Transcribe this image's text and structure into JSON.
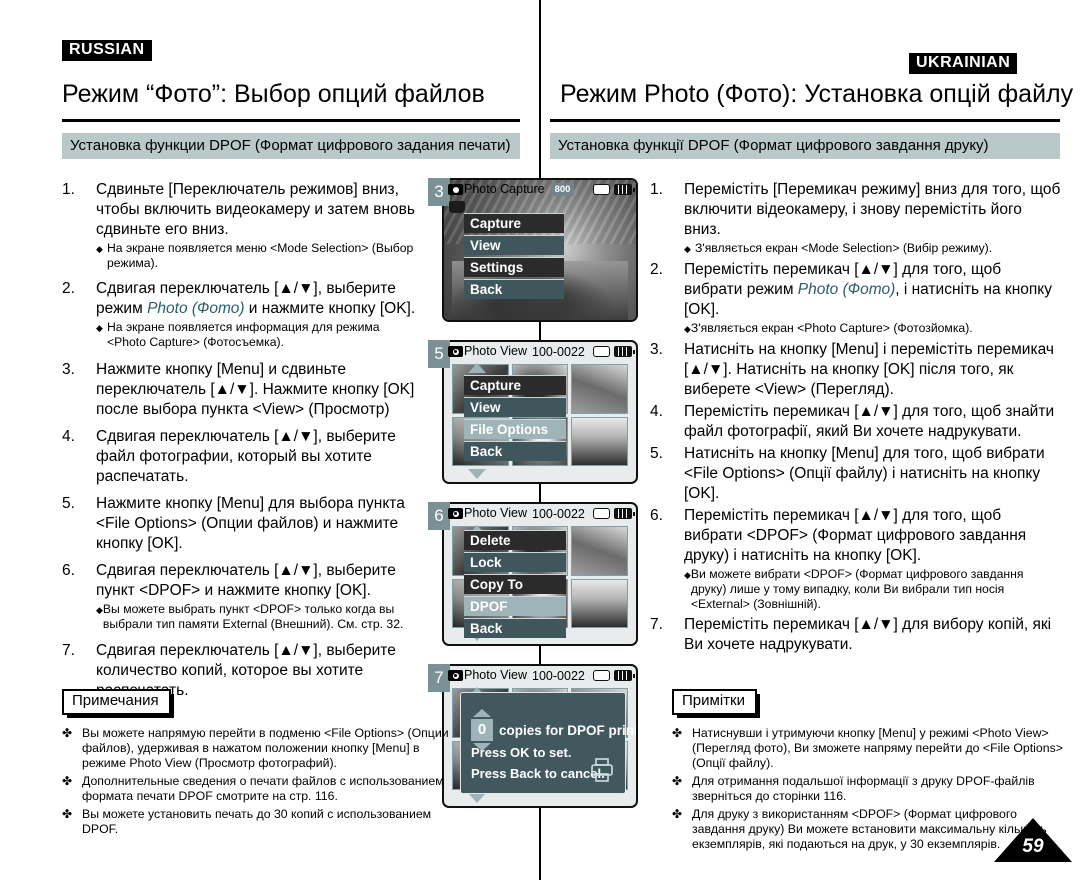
{
  "languages": {
    "left_tag": "RUSSIAN",
    "right_tag": "UKRAINIAN"
  },
  "left": {
    "chapter_title": "Режим “Фото”: Выбор опций файлов",
    "section_bar": "Установка функции DPOF (Формат цифрового задания печати)",
    "steps": [
      {
        "num": "1.",
        "text": "Сдвиньте [Переключатель режимов] вниз, чтобы включить видеокамеру и затем вновь сдвиньте его вниз.",
        "subs": [
          "На экране появляется меню <Mode Selection> (Выбор режима)."
        ]
      },
      {
        "num": "2.",
        "text_pre": "Сдвигая переключатель [▲/▼], выберите режим ",
        "text_italic": "Photo (Фото)",
        "text_post": " и нажмите кнопку [OK].",
        "subs": [
          "На экране появляется информация для режима <Photo Capture> (Фотосъемка)."
        ]
      },
      {
        "num": "3.",
        "text": "Нажмите кнопку [Menu] и сдвиньте переключатель [▲/▼]. Нажмите кнопку [OK] после выбора пункта <View> (Просмотр)",
        "subs": []
      },
      {
        "num": "4.",
        "text": "Сдвигая переключатель [▲/▼], выберите файл фотографии, который вы хотите распечатать.",
        "subs": []
      },
      {
        "num": "5.",
        "text": "Нажмите кнопку [Menu] для выбора пункта <File Options> (Опции файлов) и нажмите кнопку [OK].",
        "subs": []
      },
      {
        "num": "6.",
        "text": "Сдвигая переключатель [▲/▼], выберите пункт <DPOF> и нажмите кнопку [OK].",
        "subs": [
          "Вы можете выбрать пункт <DPOF> только когда вы выбрали тип памяти External (Внешний). См. стр. 32."
        ]
      },
      {
        "num": "7.",
        "text": "Сдвигая переключатель [▲/▼], выберите количество копий, которое вы хотите распечатать.",
        "subs": []
      }
    ],
    "notes_tab": "Примечания",
    "notes": [
      "Вы можете напрямую перейти в подменю <File Options> (Опции файлов), удерживая в нажатом положении кнопку [Menu] в режиме Photo View (Просмотр фотографий).",
      "Дополнительные сведения о печати файлов с использованием формата печати DPOF смотрите на стр. 116.",
      "Вы можете установить печать до 30 копий с использованием DPOF."
    ]
  },
  "right": {
    "chapter_title": "Режим Photo (Фото): Установка опцій файлу",
    "section_bar": "Установка функції DPOF (Формат цифрового завдання друку)",
    "steps": [
      {
        "num": "1.",
        "text": "Перемістіть [Перемикач режиму] вниз для того, щоб включити відеокамеру, і знову перемістіть його вниз.",
        "subs": [
          "З'являється екран <Mode Selection> (Вибір режиму)."
        ]
      },
      {
        "num": "2.",
        "text_pre": "Перемістіть перемикач [▲/▼] для того, щоб вибрати режим ",
        "text_italic": "Photo (Фото)",
        "text_post": ", і натисніть на кнопку [OK].",
        "subs": [
          "З'являється екран <Photo Capture> (Фотозйомка)."
        ]
      },
      {
        "num": "3.",
        "text": "Натисніть на кнопку [Menu] і перемістіть перемикач [▲/▼]. Натисніть на кнопку [OK] після того, як виберете <View> (Перегляд).",
        "subs": []
      },
      {
        "num": "4.",
        "text": "Перемістіть перемикач [▲/▼] для того, щоб знайти файл фотографії, який Ви хочете надрукувати.",
        "subs": []
      },
      {
        "num": "5.",
        "text": "Натисніть на кнопку [Menu] для того, щоб вибрати <File Options> (Опції файлу) і натисніть на кнопку [OK].",
        "subs": []
      },
      {
        "num": "6.",
        "text": "Перемістіть перемикач [▲/▼] для того, щоб вибрати <DPOF> (Формат цифрового завдання друку) і натисніть на кнопку [OK].",
        "subs": [
          "Ви можете вибрати <DPOF> (Формат цифрового завдання друку) лише у тому випадку, коли Ви вибрали тип носія <External> (Зовнішній)."
        ]
      },
      {
        "num": "7.",
        "text": "Перемістіть перемикач [▲/▼] для вибору копій, які Ви хочете надрукувати.",
        "subs": []
      }
    ],
    "notes_tab": "Примітки",
    "notes": [
      "Натиснувши і утримуючи кнопку [Menu] у режимі <Photo View> (Перегляд фото), Ви зможете напряму перейти до <File Options> (Опції файлу).",
      "Для отримання подальшої інформації з друку DPOF-файлів зверніться до сторінки 116.",
      "Для друку з використанням <DPOF> (Формат цифрового завдання друку) Ви можете встановити максимальну кількість екземплярів, які подаються на друк, у 30 екземплярів."
    ]
  },
  "lcd_screens": [
    {
      "badge": "3",
      "title": "Photo Capture",
      "file": "",
      "resolution": "800",
      "background": "photo",
      "menu": [
        {
          "label": "Capture",
          "state": "dark"
        },
        {
          "label": "View",
          "state": "normal"
        },
        {
          "label": "Settings",
          "state": "dark"
        },
        {
          "label": "Back",
          "state": "normal"
        }
      ]
    },
    {
      "badge": "5",
      "title": "Photo View",
      "file": "100-0022",
      "resolution": "",
      "background": "thumbnails",
      "menu": [
        {
          "label": "Capture",
          "state": "dark"
        },
        {
          "label": "View",
          "state": "normal"
        },
        {
          "label": "File Options",
          "state": "selected"
        },
        {
          "label": "Back",
          "state": "normal"
        }
      ]
    },
    {
      "badge": "6",
      "title": "Photo View",
      "file": "100-0022",
      "resolution": "",
      "background": "thumbnails",
      "menu": [
        {
          "label": "Delete",
          "state": "dark"
        },
        {
          "label": "Lock",
          "state": "normal"
        },
        {
          "label": "Copy To",
          "state": "dark"
        },
        {
          "label": "DPOF",
          "state": "selected"
        },
        {
          "label": "Back",
          "state": "normal"
        }
      ]
    },
    {
      "badge": "7",
      "title": "Photo View",
      "file": "100-0022",
      "resolution": "",
      "background": "thumbnails",
      "dpof": {
        "count": "0",
        "label": "copies for DPOF print",
        "hint_ok": "Press OK to set.",
        "hint_back": "Press Back to cancel."
      }
    }
  ],
  "page_number": "59",
  "colors": {
    "section_bar": "#b9c8c8",
    "badge": "#7b9196",
    "menu_normal": "#3f565d",
    "menu_dark": "#2b2b2b",
    "menu_selected": "#9fb4b8",
    "italic_accent": "#2b5c6b"
  }
}
